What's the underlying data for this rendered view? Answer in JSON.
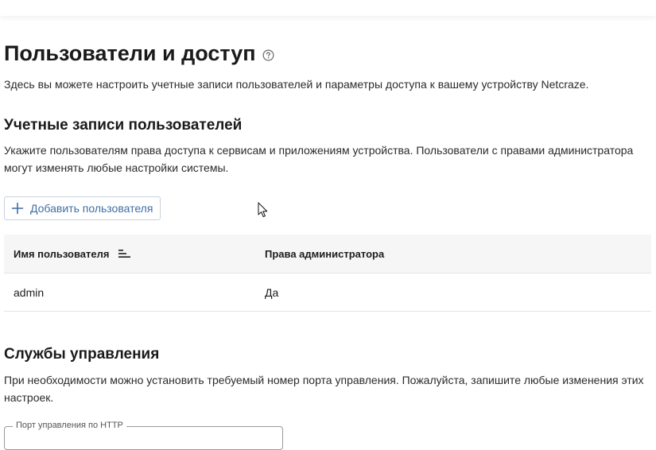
{
  "page": {
    "title": "Пользователи и доступ",
    "description": "Здесь вы можете настроить учетные записи пользователей и параметры доступа к вашему устройству Netcraze."
  },
  "accounts": {
    "title": "Учетные записи пользователей",
    "description": "Укажите пользователям права доступа к сервисам и приложениям устройства. Пользователи с правами администратора могут изменять любые настройки системы.",
    "add_button_label": "Добавить пользователя",
    "table": {
      "columns": [
        "Имя пользователя",
        "Права администратора"
      ],
      "rows": [
        {
          "username": "admin",
          "admin": "Да"
        }
      ]
    }
  },
  "management": {
    "title": "Службы управления",
    "description": "При необходимости можно установить требуемый номер порта управления. Пожалуйста, запишите любые изменения этих настроек.",
    "http_port_label": "Порт управления по HTTP"
  },
  "icons": {
    "help": "help-circle-icon",
    "add": "plus-icon",
    "sort": "sort-icon",
    "cursor": "mouse-cursor-icon"
  },
  "colors": {
    "accent": "#3f6fa6",
    "button_border": "#c9d2dc",
    "table_header_bg": "#f6f6f6"
  }
}
